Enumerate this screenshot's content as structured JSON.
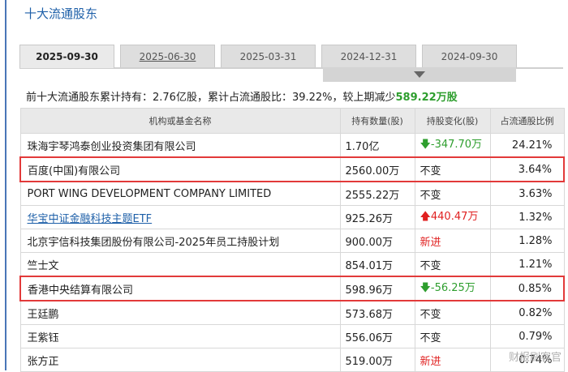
{
  "page": {
    "title": "十大流通股东"
  },
  "tabs": [
    {
      "label": "2025-09-30",
      "active": true
    },
    {
      "label": "2025-06-30",
      "active": false
    },
    {
      "label": "2025-03-31",
      "active": false
    },
    {
      "label": "2024-12-31",
      "active": false
    },
    {
      "label": "2024-09-30",
      "active": false
    }
  ],
  "summary": {
    "part1": "前十大流通股东累计持有：2.76亿股，累计占流通股比：39.22%，较上期减少",
    "amount": "589.22万股"
  },
  "table": {
    "headers": [
      "机构或基金名称",
      "持有数量(股)",
      "持股变化(股)",
      "占流通股比例"
    ],
    "rows": [
      {
        "name": "珠海宇琴鸿泰创业投资集团有限公司",
        "hold": "1.70亿",
        "change": "-347.70万",
        "ratio": "24.21%"
      },
      {
        "name": "百度(中国)有限公司",
        "hold": "2560.00万",
        "change": "不变",
        "ratio": "3.64%"
      },
      {
        "name": "PORT WING DEVELOPMENT COMPANY LIMITED",
        "hold": "2555.22万",
        "change": "不变",
        "ratio": "3.63%"
      },
      {
        "name": "华宝中证金融科技主题ETF",
        "hold": "925.26万",
        "change": "440.47万",
        "ratio": "1.32%"
      },
      {
        "name": "北京宇信科技集团股份有限公司-2025年员工持股计划",
        "hold": "900.00万",
        "change": "新进",
        "ratio": "1.28%"
      },
      {
        "name": "竺士文",
        "hold": "854.01万",
        "change": "不变",
        "ratio": "1.21%"
      },
      {
        "name": "香港中央结算有限公司",
        "hold": "598.96万",
        "change": "-56.25万",
        "ratio": "0.85%"
      },
      {
        "name": "王廷鹏",
        "hold": "573.68万",
        "change": "不变",
        "ratio": "0.82%"
      },
      {
        "name": "王紫钰",
        "hold": "556.06万",
        "change": "不变",
        "ratio": "0.79%"
      },
      {
        "name": "张方正",
        "hold": "519.00万",
        "change": "新进",
        "ratio": "0.74%"
      }
    ]
  },
  "watermark": "财报刷客官",
  "colors": {
    "accent": "#1d5fa8",
    "down": "#2e9e2e",
    "up": "#e02020",
    "highlight_border": "#e23a3a"
  }
}
